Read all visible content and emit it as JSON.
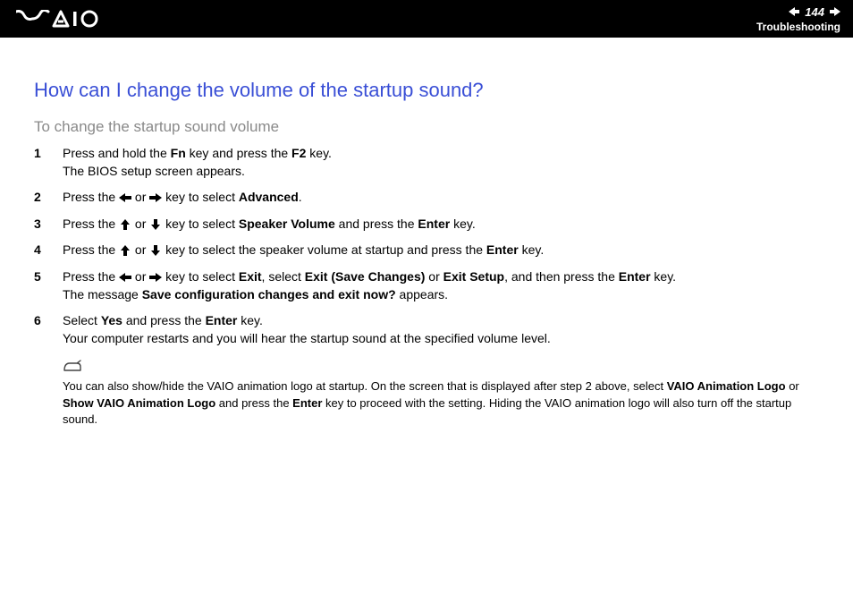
{
  "header": {
    "page_number": "144",
    "section": "Troubleshooting"
  },
  "title": "How can I change the volume of the startup sound?",
  "subtitle": "To change the startup sound volume",
  "steps": [
    {
      "num": "1",
      "parts": [
        {
          "t": "Press and hold the "
        },
        {
          "t": "Fn",
          "b": true
        },
        {
          "t": " key and press the "
        },
        {
          "t": "F2",
          "b": true
        },
        {
          "t": " key."
        },
        {
          "br": true
        },
        {
          "t": "The BIOS setup screen appears."
        }
      ]
    },
    {
      "num": "2",
      "parts": [
        {
          "t": "Press the "
        },
        {
          "arrow": "left"
        },
        {
          "t": " or "
        },
        {
          "arrow": "right"
        },
        {
          "t": " key to select "
        },
        {
          "t": "Advanced",
          "b": true
        },
        {
          "t": "."
        }
      ]
    },
    {
      "num": "3",
      "parts": [
        {
          "t": "Press the "
        },
        {
          "arrow": "up"
        },
        {
          "t": " or "
        },
        {
          "arrow": "down"
        },
        {
          "t": " key to select "
        },
        {
          "t": "Speaker Volume",
          "b": true
        },
        {
          "t": " and press the "
        },
        {
          "t": "Enter",
          "b": true
        },
        {
          "t": " key."
        }
      ]
    },
    {
      "num": "4",
      "parts": [
        {
          "t": "Press the "
        },
        {
          "arrow": "up"
        },
        {
          "t": " or "
        },
        {
          "arrow": "down"
        },
        {
          "t": " key to select the speaker volume at startup and press the "
        },
        {
          "t": "Enter",
          "b": true
        },
        {
          "t": " key."
        }
      ]
    },
    {
      "num": "5",
      "parts": [
        {
          "t": "Press the "
        },
        {
          "arrow": "left"
        },
        {
          "t": " or "
        },
        {
          "arrow": "right"
        },
        {
          "t": " key to select "
        },
        {
          "t": "Exit",
          "b": true
        },
        {
          "t": ", select "
        },
        {
          "t": "Exit (Save Changes)",
          "b": true
        },
        {
          "t": " or "
        },
        {
          "t": "Exit Setup",
          "b": true
        },
        {
          "t": ", and then press the "
        },
        {
          "t": "Enter",
          "b": true
        },
        {
          "t": " key."
        },
        {
          "br": true
        },
        {
          "t": "The message "
        },
        {
          "t": "Save configuration changes and exit now?",
          "b": true
        },
        {
          "t": " appears."
        }
      ]
    },
    {
      "num": "6",
      "parts": [
        {
          "t": "Select "
        },
        {
          "t": "Yes",
          "b": true
        },
        {
          "t": " and press the "
        },
        {
          "t": "Enter",
          "b": true
        },
        {
          "t": " key."
        },
        {
          "br": true
        },
        {
          "t": "Your computer restarts and you will hear the startup sound at the specified volume level."
        }
      ]
    }
  ],
  "note": {
    "parts": [
      {
        "t": "You can also show/hide the VAIO animation logo at startup. On the screen that is displayed after step 2 above, select "
      },
      {
        "t": "VAIO Animation Logo",
        "b": true
      },
      {
        "t": " or "
      },
      {
        "t": "Show VAIO Animation Logo",
        "b": true
      },
      {
        "t": " and press the "
      },
      {
        "t": "Enter",
        "b": true
      },
      {
        "t": " key to proceed with the setting. Hiding the VAIO animation logo will also turn off the startup sound."
      }
    ]
  }
}
